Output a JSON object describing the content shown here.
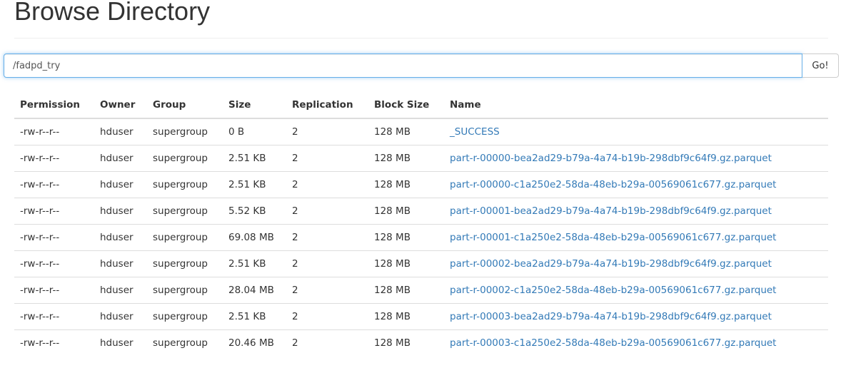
{
  "page_title": "Browse Directory",
  "path_bar": {
    "value": "/fadpd_try",
    "go_label": "Go!"
  },
  "table": {
    "headers": [
      "Permission",
      "Owner",
      "Group",
      "Size",
      "Replication",
      "Block Size",
      "Name"
    ],
    "rows": [
      {
        "permission": "-rw-r--r--",
        "owner": "hduser",
        "group": "supergroup",
        "size": "0 B",
        "replication": "2",
        "block_size": "128 MB",
        "name": "_SUCCESS"
      },
      {
        "permission": "-rw-r--r--",
        "owner": "hduser",
        "group": "supergroup",
        "size": "2.51 KB",
        "replication": "2",
        "block_size": "128 MB",
        "name": "part-r-00000-bea2ad29-b79a-4a74-b19b-298dbf9c64f9.gz.parquet"
      },
      {
        "permission": "-rw-r--r--",
        "owner": "hduser",
        "group": "supergroup",
        "size": "2.51 KB",
        "replication": "2",
        "block_size": "128 MB",
        "name": "part-r-00000-c1a250e2-58da-48eb-b29a-00569061c677.gz.parquet"
      },
      {
        "permission": "-rw-r--r--",
        "owner": "hduser",
        "group": "supergroup",
        "size": "5.52 KB",
        "replication": "2",
        "block_size": "128 MB",
        "name": "part-r-00001-bea2ad29-b79a-4a74-b19b-298dbf9c64f9.gz.parquet"
      },
      {
        "permission": "-rw-r--r--",
        "owner": "hduser",
        "group": "supergroup",
        "size": "69.08 MB",
        "replication": "2",
        "block_size": "128 MB",
        "name": "part-r-00001-c1a250e2-58da-48eb-b29a-00569061c677.gz.parquet"
      },
      {
        "permission": "-rw-r--r--",
        "owner": "hduser",
        "group": "supergroup",
        "size": "2.51 KB",
        "replication": "2",
        "block_size": "128 MB",
        "name": "part-r-00002-bea2ad29-b79a-4a74-b19b-298dbf9c64f9.gz.parquet"
      },
      {
        "permission": "-rw-r--r--",
        "owner": "hduser",
        "group": "supergroup",
        "size": "28.04 MB",
        "replication": "2",
        "block_size": "128 MB",
        "name": "part-r-00002-c1a250e2-58da-48eb-b29a-00569061c677.gz.parquet"
      },
      {
        "permission": "-rw-r--r--",
        "owner": "hduser",
        "group": "supergroup",
        "size": "2.51 KB",
        "replication": "2",
        "block_size": "128 MB",
        "name": "part-r-00003-bea2ad29-b79a-4a74-b19b-298dbf9c64f9.gz.parquet"
      },
      {
        "permission": "-rw-r--r--",
        "owner": "hduser",
        "group": "supergroup",
        "size": "20.46 MB",
        "replication": "2",
        "block_size": "128 MB",
        "name": "part-r-00003-c1a250e2-58da-48eb-b29a-00569061c677.gz.parquet"
      }
    ]
  },
  "colors": {
    "link": "#337ab7",
    "input_focus_border": "#66afe9",
    "text": "#333333",
    "row_border": "#dddddd"
  }
}
